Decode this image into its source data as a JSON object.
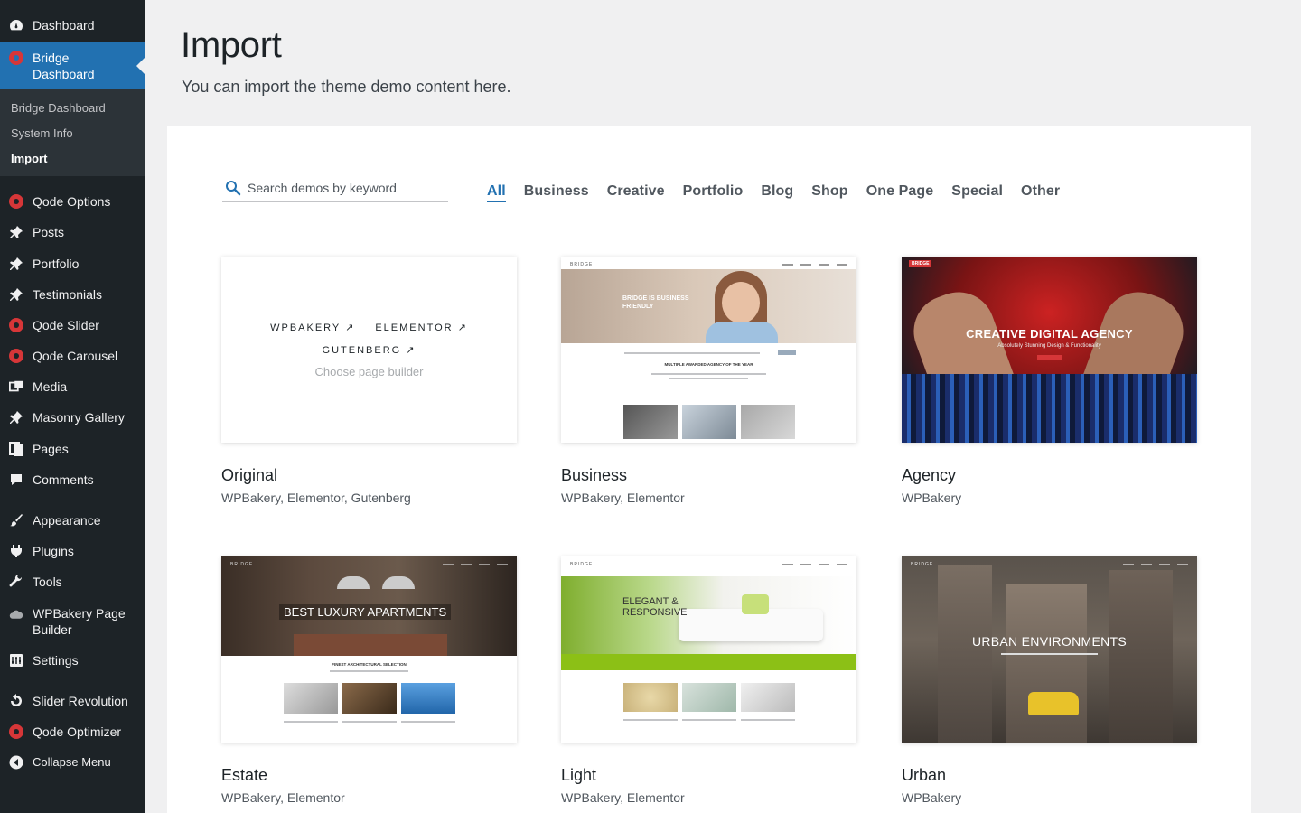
{
  "sidebar": {
    "dashboard": "Dashboard",
    "bridge_dashboard": "Bridge Dashboard",
    "submenu": [
      "Bridge Dashboard",
      "System Info",
      "Import"
    ],
    "qode_options": "Qode Options",
    "posts": "Posts",
    "portfolio": "Portfolio",
    "testimonials": "Testimonials",
    "qode_slider": "Qode Slider",
    "qode_carousel": "Qode Carousel",
    "media": "Media",
    "masonry_gallery": "Masonry Gallery",
    "pages": "Pages",
    "comments": "Comments",
    "appearance": "Appearance",
    "plugins": "Plugins",
    "tools": "Tools",
    "wpbakery": "WPBakery Page Builder",
    "settings": "Settings",
    "slider_revolution": "Slider Revolution",
    "qode_optimizer": "Qode Optimizer",
    "collapse": "Collapse Menu"
  },
  "header": {
    "title": "Import",
    "subtitle": "You can import the theme demo content here."
  },
  "search": {
    "placeholder": "Search demos by keyword"
  },
  "filters": [
    "All",
    "Business",
    "Creative",
    "Portfolio",
    "Blog",
    "Shop",
    "One Page",
    "Special",
    "Other"
  ],
  "active_filter": "All",
  "original_card": {
    "builders": [
      "WPBAKERY ↗",
      "ELEMENTOR ↗",
      "GUTENBERG ↗"
    ],
    "hint": "Choose page builder"
  },
  "demos": [
    {
      "title": "Original",
      "tags": "WPBakery,  Elementor,  Gutenberg"
    },
    {
      "title": "Business",
      "tags": "WPBakery,  Elementor",
      "hero": "BRIDGE IS BUSINESS FRIENDLY",
      "section": "MULTIPLE AWARDED AGENCY OF THE YEAR",
      "brand": "BRIDGE"
    },
    {
      "title": "Agency",
      "tags": "WPBakery",
      "hero": "CREATIVE DIGITAL AGENCY",
      "sub": "Absolutely Stunning Design & Functionality",
      "badge": "BRIDGE"
    },
    {
      "title": "Estate",
      "tags": "WPBakery,  Elementor",
      "hero": "BEST LUXURY APARTMENTS",
      "section": "FINEST ARCHITECTURAL SELECTION",
      "brand": "BRIDGE"
    },
    {
      "title": "Light",
      "tags": "WPBakery,  Elementor",
      "hero": "ELEGANT & RESPONSIVE",
      "brand": "BRIDGE"
    },
    {
      "title": "Urban",
      "tags": "WPBakery",
      "hero": "URBAN ENVIRONMENTS",
      "brand": "BRIDGE"
    }
  ],
  "colors": {
    "accent": "#2271b1",
    "sidebar": "#1d2327",
    "qode_red": "#d63638",
    "light_green": "#8cc016"
  }
}
